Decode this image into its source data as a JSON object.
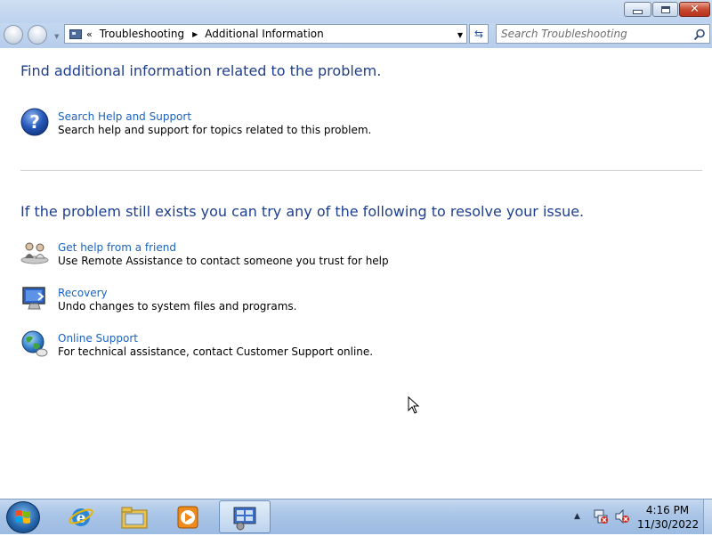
{
  "window": {
    "caption_buttons": [
      "minimize",
      "maximize",
      "close"
    ]
  },
  "navbar": {
    "address": {
      "chevron": "«",
      "crumbs": [
        "Troubleshooting",
        "Additional Information"
      ]
    },
    "search_placeholder": "Search Troubleshooting"
  },
  "content": {
    "heading_1": "Find additional information related to the problem.",
    "help_item": {
      "link": "Search Help and Support",
      "desc": "Search help and support for topics related to this problem.",
      "icon": "help-question-icon"
    },
    "heading_2": "If the problem still exists you can try any of the following to resolve your issue.",
    "options": [
      {
        "link": "Get help from a friend",
        "desc": "Use Remote Assistance to contact someone you trust for help",
        "icon": "remote-assistance-icon"
      },
      {
        "link": "Recovery",
        "desc": "Undo changes to system files and programs.",
        "icon": "recovery-icon"
      },
      {
        "link": "Online Support",
        "desc": "For technical assistance, contact Customer Support online.",
        "icon": "online-support-globe-icon"
      }
    ]
  },
  "taskbar": {
    "apps": [
      {
        "name": "internet-explorer",
        "icon": "ie-icon"
      },
      {
        "name": "windows-explorer",
        "icon": "folder-icon"
      },
      {
        "name": "media-player",
        "icon": "media-player-icon"
      },
      {
        "name": "control-panel",
        "icon": "control-panel-icon",
        "active": true
      }
    ],
    "tray": {
      "time": "4:16 PM",
      "date": "11/30/2022"
    }
  },
  "colors": {
    "heading": "#1e3f8f",
    "link": "#1b62bd",
    "chrome": "#bcd2ee"
  }
}
